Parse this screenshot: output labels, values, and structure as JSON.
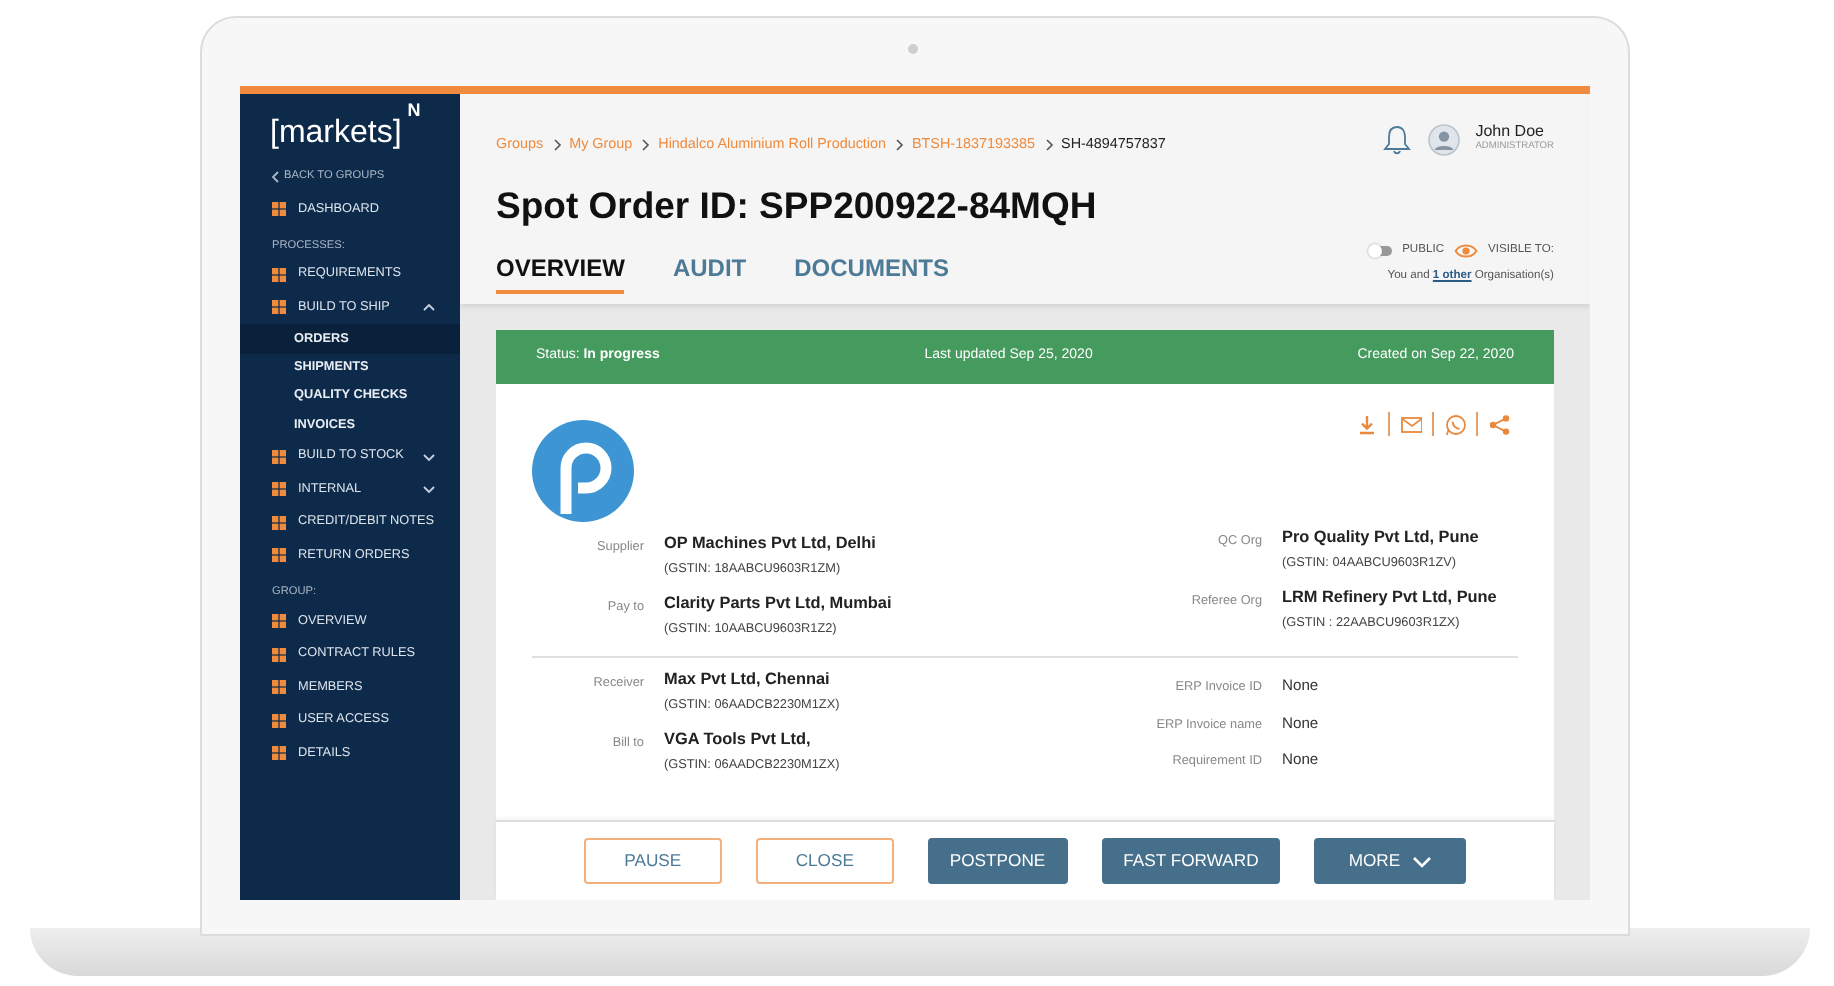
{
  "brand": {
    "name": "[markets]",
    "superscript": "N"
  },
  "back_link": "BACK TO GROUPS",
  "sidebar": {
    "items": [
      {
        "kind": "item",
        "label": "DASHBOARD"
      },
      {
        "kind": "heading",
        "label": "PROCESSES:"
      },
      {
        "kind": "item",
        "label": "REQUIREMENTS"
      },
      {
        "kind": "item",
        "label": "BUILD TO SHIP",
        "expanded": true,
        "children": [
          {
            "label": "ORDERS",
            "selected": true
          },
          {
            "label": "SHIPMENTS",
            "selected": false
          },
          {
            "label": "QUALITY CHECKS",
            "selected": false
          },
          {
            "label": "INVOICES",
            "selected": false
          }
        ]
      },
      {
        "kind": "item",
        "label": "BUILD TO STOCK",
        "expanded": false
      },
      {
        "kind": "item",
        "label": "INTERNAL",
        "expanded": false
      },
      {
        "kind": "item",
        "label": "CREDIT/DEBIT NOTES"
      },
      {
        "kind": "item",
        "label": "RETURN ORDERS"
      },
      {
        "kind": "heading",
        "label": "GROUP:"
      },
      {
        "kind": "item",
        "label": "OVERVIEW"
      },
      {
        "kind": "item",
        "label": "CONTRACT RULES"
      },
      {
        "kind": "item",
        "label": "MEMBERS"
      },
      {
        "kind": "item",
        "label": "USER ACCESS"
      },
      {
        "kind": "item",
        "label": "DETAILS"
      }
    ]
  },
  "breadcrumbs": [
    {
      "label": "Groups",
      "current": false
    },
    {
      "label": "My Group",
      "current": false
    },
    {
      "label": "Hindalco Aluminium Roll Production",
      "current": false
    },
    {
      "label": "BTSH-1837193385",
      "current": false
    },
    {
      "label": "SH-4894757837",
      "current": true
    }
  ],
  "user": {
    "name": "John Doe",
    "role": "ADMINISTRATOR"
  },
  "title": "Spot Order ID: SPP200922-84MQH",
  "tabs": [
    {
      "label": "OVERVIEW",
      "selected": true
    },
    {
      "label": "AUDIT",
      "selected": false
    },
    {
      "label": "DOCUMENTS",
      "selected": false
    }
  ],
  "visibility": {
    "public": false,
    "public_label": "PUBLIC",
    "visible_label": "VISIBLE TO:",
    "note_before": "You and",
    "link": "1 other",
    "note_after": "Organisation(s)"
  },
  "status_bar": {
    "label": "Status:",
    "value": "In progress",
    "last_updated": "Last updated Sep 25, 2020",
    "created": "Created on Sep 22, 2020"
  },
  "parties_left": [
    {
      "label": "Supplier",
      "name": "OP Machines Pvt Ltd, Delhi",
      "gstin": "(GSTIN: 18AABCU9603R1ZM)"
    },
    {
      "label": "Pay to",
      "name": "Clarity Parts Pvt Ltd, Mumbai",
      "gstin": "(GSTIN: 10AABCU9603R1Z2)"
    }
  ],
  "parties_right": [
    {
      "label": "QC Org",
      "name": "Pro Quality Pvt Ltd, Pune",
      "gstin": "(GSTIN: 04AABCU9603R1ZV)"
    },
    {
      "label": "Referee Org",
      "name": "LRM Refinery Pvt Ltd, Pune",
      "gstin": "(GSTIN : 22AABCU9603R1ZX)"
    }
  ],
  "details_left": [
    {
      "label": "Receiver",
      "name": "Max Pvt Ltd, Chennai",
      "gstin": "(GSTIN: 06AADCB2230M1ZX)"
    },
    {
      "label": "Bill to",
      "name": "VGA Tools Pvt Ltd,",
      "gstin": "(GSTIN: 06AADCB2230M1ZX)"
    }
  ],
  "details_right": [
    {
      "label": "ERP Invoice ID",
      "value": "None"
    },
    {
      "label": "ERP Invoice name",
      "value": "None"
    },
    {
      "label": "Requirement ID",
      "value": "None"
    }
  ],
  "buttons": [
    {
      "label": "PAUSE",
      "kind": "outline"
    },
    {
      "label": "CLOSE",
      "kind": "outline"
    },
    {
      "label": "POSTPONE",
      "kind": "filled"
    },
    {
      "label": "FAST FORWARD",
      "kind": "filled"
    },
    {
      "label": "MORE",
      "kind": "dropdown"
    }
  ]
}
